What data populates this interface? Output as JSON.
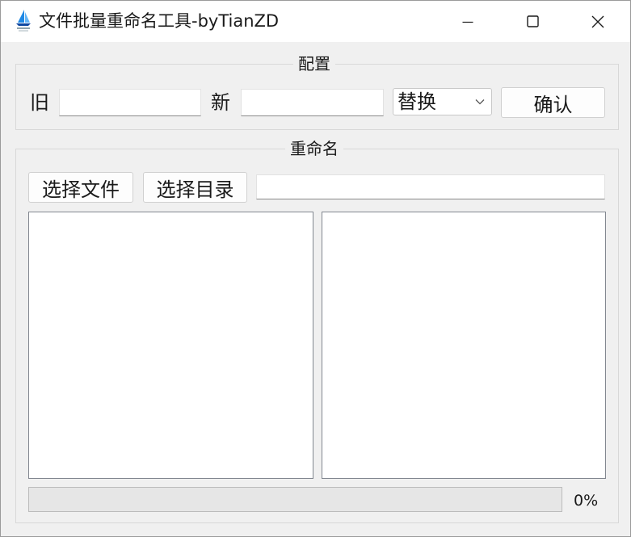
{
  "window": {
    "title": "文件批量重命名工具-byTianZD",
    "app_icon": "sailboat-icon",
    "controls": [
      "minimize-icon",
      "maximize-icon",
      "close-icon"
    ]
  },
  "config": {
    "legend": "配置",
    "old_label": "旧",
    "old_value": "",
    "new_label": "新",
    "new_value": "",
    "mode_select": "替换",
    "confirm_label": "确认"
  },
  "rename": {
    "legend": "重命名",
    "select_files_label": "选择文件",
    "select_dir_label": "选择目录",
    "path_value": "",
    "source_list": [],
    "result_list": [],
    "progress": {
      "value": 0,
      "text": "0%"
    }
  }
}
